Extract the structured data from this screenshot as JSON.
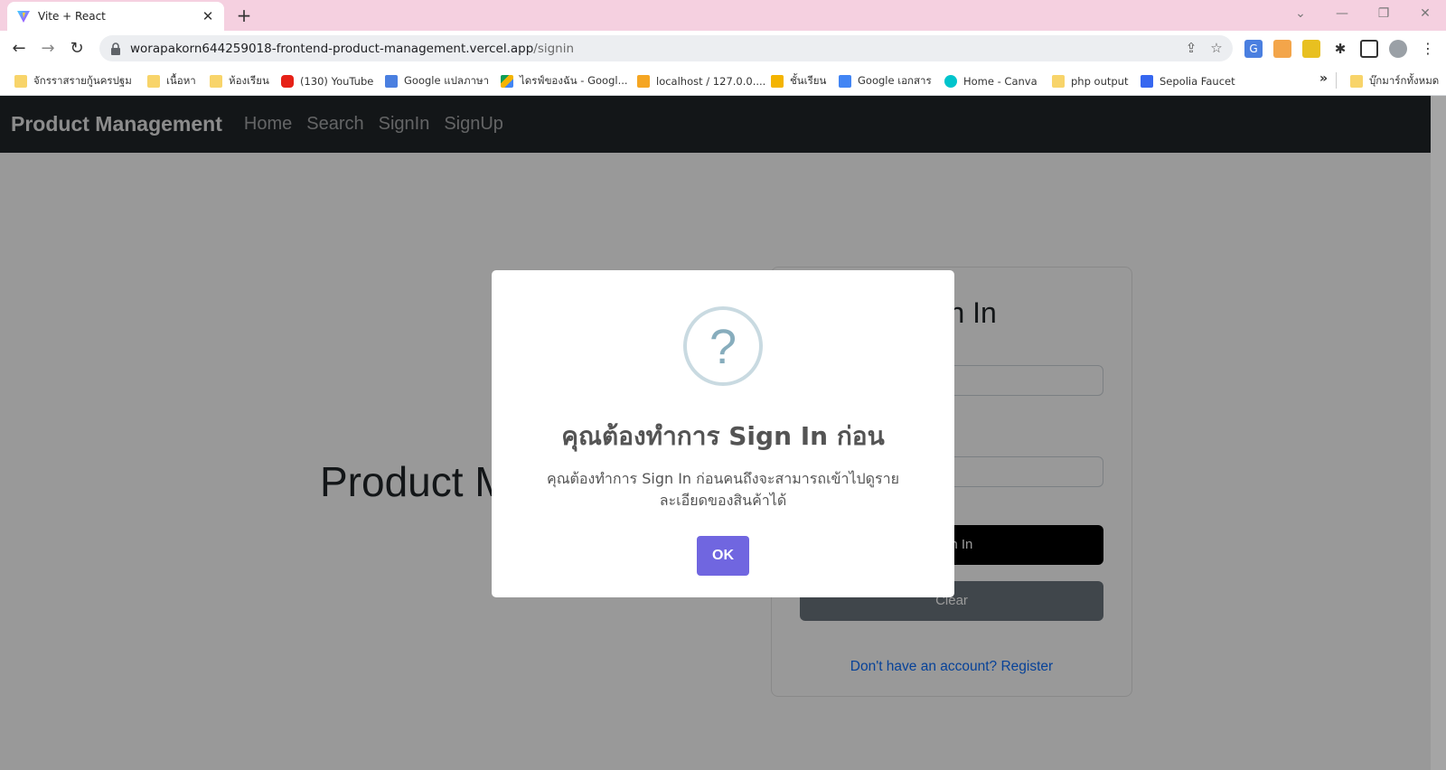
{
  "browser": {
    "tab_title": "Vite + React",
    "tab_close": "✕",
    "new_tab": "+",
    "url_host": "worapakorn644259018-frontend-product-management.vercel.app",
    "url_path": "/signin",
    "back": "←",
    "forward": "→",
    "reload": "↻",
    "minimize": "—",
    "restore": "❐",
    "close": "✕",
    "tab_search": "⌄",
    "share": "⇪",
    "star": "☆",
    "menu": "⋮"
  },
  "bookmarks": [
    {
      "label": "จักรราสรายกู้นครปฐม",
      "icon": "folder-icon"
    },
    {
      "label": "เนื้อหา",
      "icon": "folder-icon"
    },
    {
      "label": "ห้องเรียน",
      "icon": "folder-icon"
    },
    {
      "label": "(130) YouTube",
      "icon": "youtube-icon"
    },
    {
      "label": "Google แปลภาษา",
      "icon": "google-translate-icon"
    },
    {
      "label": "ไดรฟ์ของฉัน - Googl...",
      "icon": "google-drive-icon"
    },
    {
      "label": "localhost / 127.0.0....",
      "icon": "phpmyadmin-icon"
    },
    {
      "label": "ชั้นเรียน",
      "icon": "classroom-icon"
    },
    {
      "label": "Google เอกสาร",
      "icon": "google-docs-icon"
    },
    {
      "label": "Home - Canva",
      "icon": "canva-icon"
    },
    {
      "label": "php output",
      "icon": "folder-icon"
    },
    {
      "label": "Sepolia Faucet",
      "icon": "alchemy-icon"
    }
  ],
  "bookmarks_more": "»",
  "bookmarks_all": "บุ๊กมาร์กทั้งหมด",
  "app": {
    "brand": "Product Management",
    "nav": [
      "Home",
      "Search",
      "SignIn",
      "SignUp"
    ],
    "hero_title": "Product Management",
    "card_title": "Sign In",
    "signin_button": "Sign In",
    "clear_button": "Clear",
    "register_link": "Don't have an account? Register"
  },
  "modal": {
    "icon": "?",
    "title": "คุณต้องทำการ Sign In ก่อน",
    "text": "คุณต้องทำการ Sign In ก่อนคนถึงจะสามารถเข้าไปดูรายละเอียดของสินค้าได้",
    "ok": "OK"
  },
  "colors": {
    "tabstrip": "#f5d0e0",
    "navbar": "#212529",
    "ok_button": "#7066e0",
    "signin_button": "#000000",
    "clear_button": "#6c757d",
    "link": "#0d6efd"
  }
}
